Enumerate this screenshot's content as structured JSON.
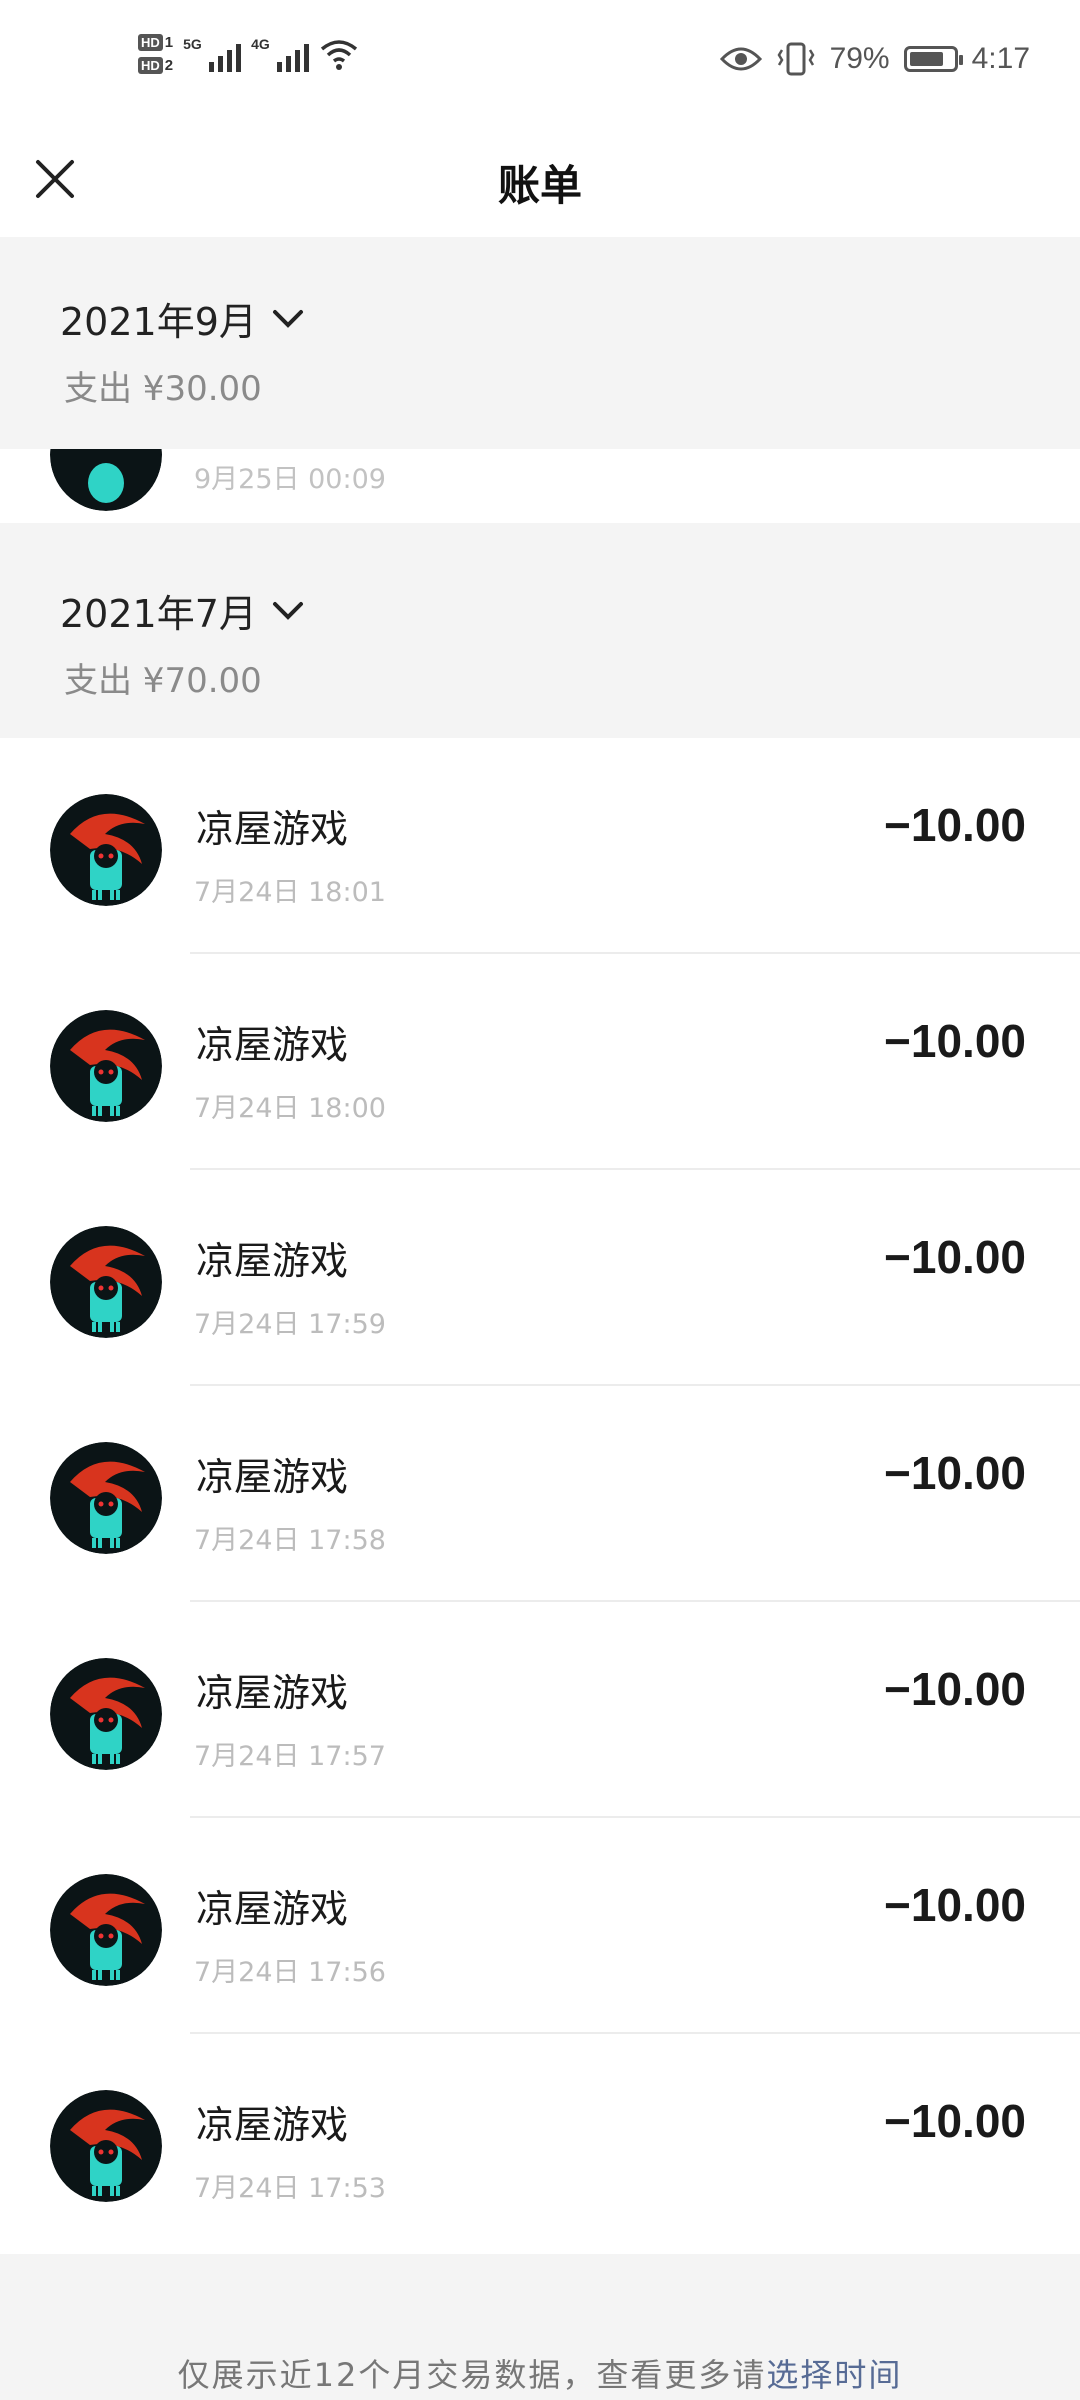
{
  "status_bar": {
    "sim1": "HD",
    "sim1_num": "1",
    "sim2": "HD",
    "sim2_num": "2",
    "net1": "5G",
    "net2": "4G",
    "battery_percent": "79%",
    "battery_level": 0.79,
    "time": "4:17",
    "icons": [
      "signal-icon",
      "wifi-icon",
      "eye-icon",
      "vibrate-icon",
      "battery-icon"
    ]
  },
  "nav": {
    "title": "账单",
    "close_icon": "close-icon"
  },
  "months": [
    {
      "label": "2021年9月",
      "total": "支出 ¥30.00"
    },
    {
      "label": "2021年7月",
      "total": "支出 ¥70.00"
    }
  ],
  "partial_row": {
    "time": "9月25日 00:09"
  },
  "transactions": [
    {
      "name": "凉屋游戏",
      "time": "7月24日 18:01",
      "amount": "−10.00"
    },
    {
      "name": "凉屋游戏",
      "time": "7月24日 18:00",
      "amount": "−10.00"
    },
    {
      "name": "凉屋游戏",
      "time": "7月24日 17:59",
      "amount": "−10.00"
    },
    {
      "name": "凉屋游戏",
      "time": "7月24日 17:58",
      "amount": "−10.00"
    },
    {
      "name": "凉屋游戏",
      "time": "7月24日 17:57",
      "amount": "−10.00"
    },
    {
      "name": "凉屋游戏",
      "time": "7月24日 17:56",
      "amount": "−10.00"
    },
    {
      "name": "凉屋游戏",
      "time": "7月24日 17:53",
      "amount": "−10.00"
    }
  ],
  "footer": {
    "text": "仅展示近12个月交易数据，查看更多请",
    "link": "选择时间"
  },
  "colors": {
    "link": "#576b95",
    "header_bg": "#f4f4f4",
    "muted_text": "#8a8a8a"
  }
}
